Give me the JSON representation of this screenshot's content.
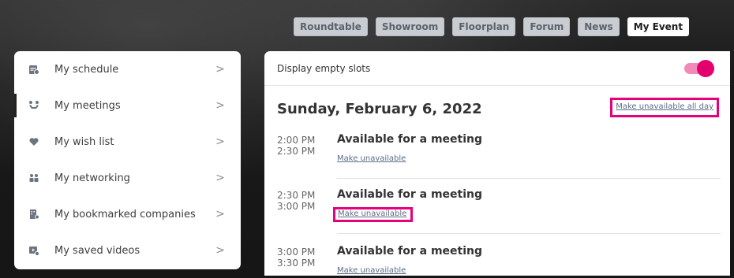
{
  "topnav": {
    "items": [
      {
        "label": "Roundtable",
        "active": false
      },
      {
        "label": "Showroom",
        "active": false
      },
      {
        "label": "Floorplan",
        "active": false
      },
      {
        "label": "Forum",
        "active": false
      },
      {
        "label": "News",
        "active": false
      },
      {
        "label": "My Event",
        "active": true
      }
    ]
  },
  "sidebar": {
    "items": [
      {
        "label": "My schedule",
        "icon": "calendar-icon"
      },
      {
        "label": "My meetings",
        "icon": "handshake-icon",
        "active": true
      },
      {
        "label": "My wish list",
        "icon": "heart-hand-icon"
      },
      {
        "label": "My networking",
        "icon": "people-icon"
      },
      {
        "label": "My bookmarked companies",
        "icon": "bookmark-building-icon"
      },
      {
        "label": "My saved videos",
        "icon": "video-icon"
      }
    ],
    "chevron": ">"
  },
  "main": {
    "toggle_label": "Display empty slots",
    "toggle_on": true,
    "date": "Sunday, February 6, 2022",
    "all_day_link": "Make unavailable all day",
    "slots": [
      {
        "start": "2:00 PM",
        "end": "2:30 PM",
        "title": "Available for a meeting",
        "link": "Make unavailable"
      },
      {
        "start": "2:30 PM",
        "end": "3:00 PM",
        "title": "Available for a meeting",
        "link": "Make unavailable"
      },
      {
        "start": "3:00 PM",
        "end": "3:30 PM",
        "title": "Available for a meeting",
        "link": "Make unavailable"
      }
    ]
  },
  "colors": {
    "accent": "#e3006e",
    "highlight_box": "#e6007a",
    "link": "#5b6d86"
  }
}
